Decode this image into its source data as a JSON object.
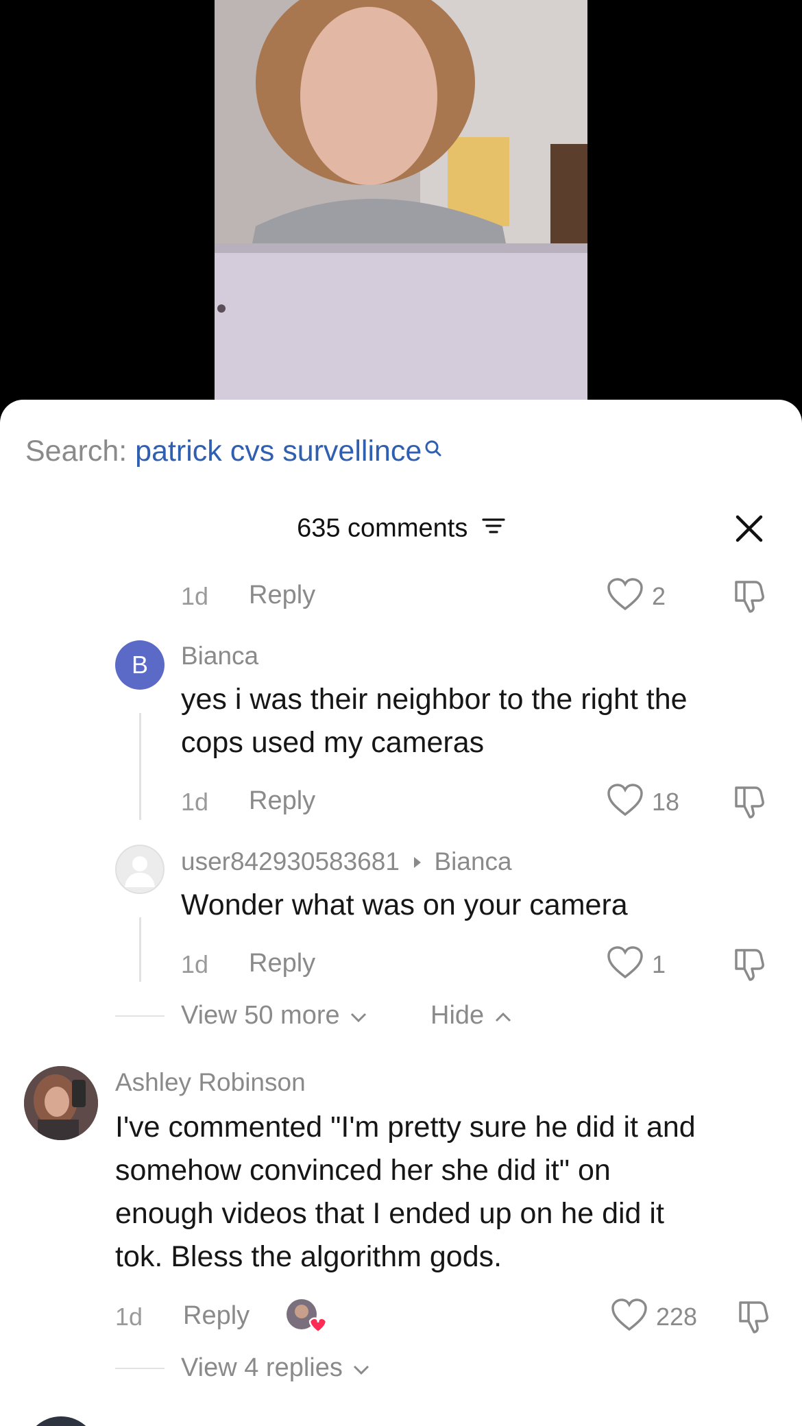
{
  "search": {
    "label": "Search:",
    "query": "patrick cvs survellince"
  },
  "header": {
    "comments_count": "635 comments"
  },
  "top_row": {
    "time": "1d",
    "reply": "Reply",
    "likes": "2"
  },
  "comments": [
    {
      "avatar_letter": "B",
      "username": "Bianca",
      "text_line1": "yes i was their neighbor to the right the",
      "text_line2": "cops used my cameras",
      "time": "1d",
      "reply": "Reply",
      "likes": "18"
    },
    {
      "username": "user842930583681",
      "reply_to": "Bianca",
      "text": "Wonder what was on your camera",
      "time": "1d",
      "reply": "Reply",
      "likes": "1"
    }
  ],
  "thread_controls": {
    "view_more": "View 50 more",
    "hide": "Hide"
  },
  "main_comment": {
    "username": "Ashley Robinson",
    "lines": [
      "I've commented \"I'm pretty sure he did it and",
      "somehow convinced her she did it\" on",
      "enough videos that I ended up on he did it",
      "tok. Bless the algorithm gods."
    ],
    "time": "1d",
    "reply": "Reply",
    "likes": "228",
    "view_replies": "View 4 replies"
  },
  "colors": {
    "accent_link": "#2f5fb0",
    "avatar_b": "#5b6ac6",
    "like_heart": "#fe2c55"
  }
}
